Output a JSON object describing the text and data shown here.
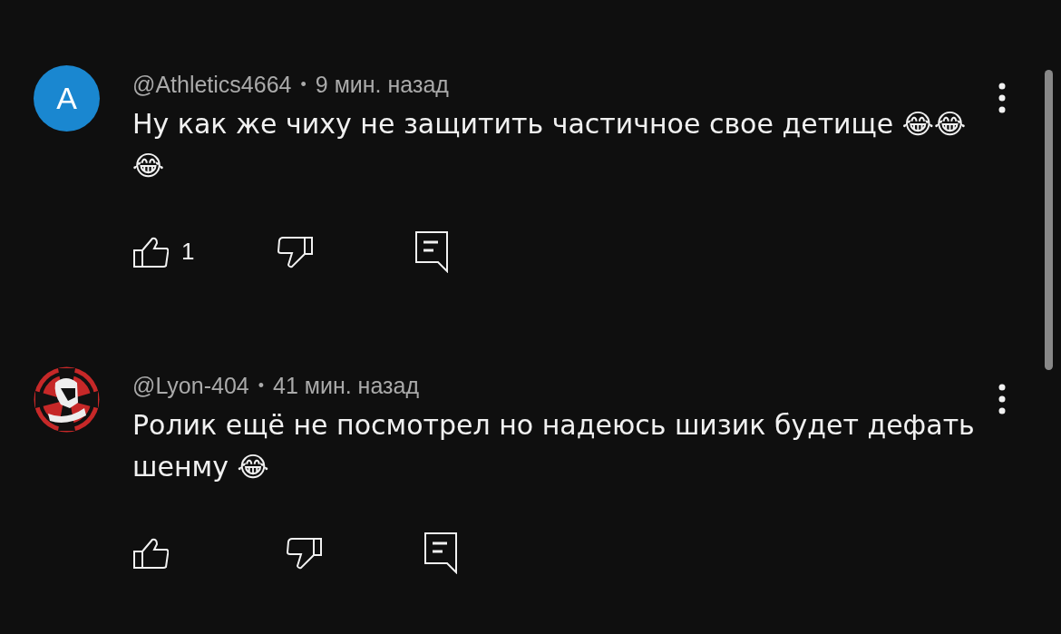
{
  "comments": [
    {
      "avatar": {
        "kind": "letter",
        "letter": "A",
        "color": "#1a87d0"
      },
      "author": "@Athletics4664",
      "time": "9 мин. назад",
      "text": "Ну как же чиху не защитить частичное свое детище 😂😂😂",
      "likes": "1"
    },
    {
      "avatar": {
        "kind": "image"
      },
      "author": "@Lyon-404",
      "time": "41 мин. назад",
      "text": "Ролик ещё не посмотрел но надеюсь шизик будет дефать шенму 😂"
    }
  ],
  "separator": "•"
}
